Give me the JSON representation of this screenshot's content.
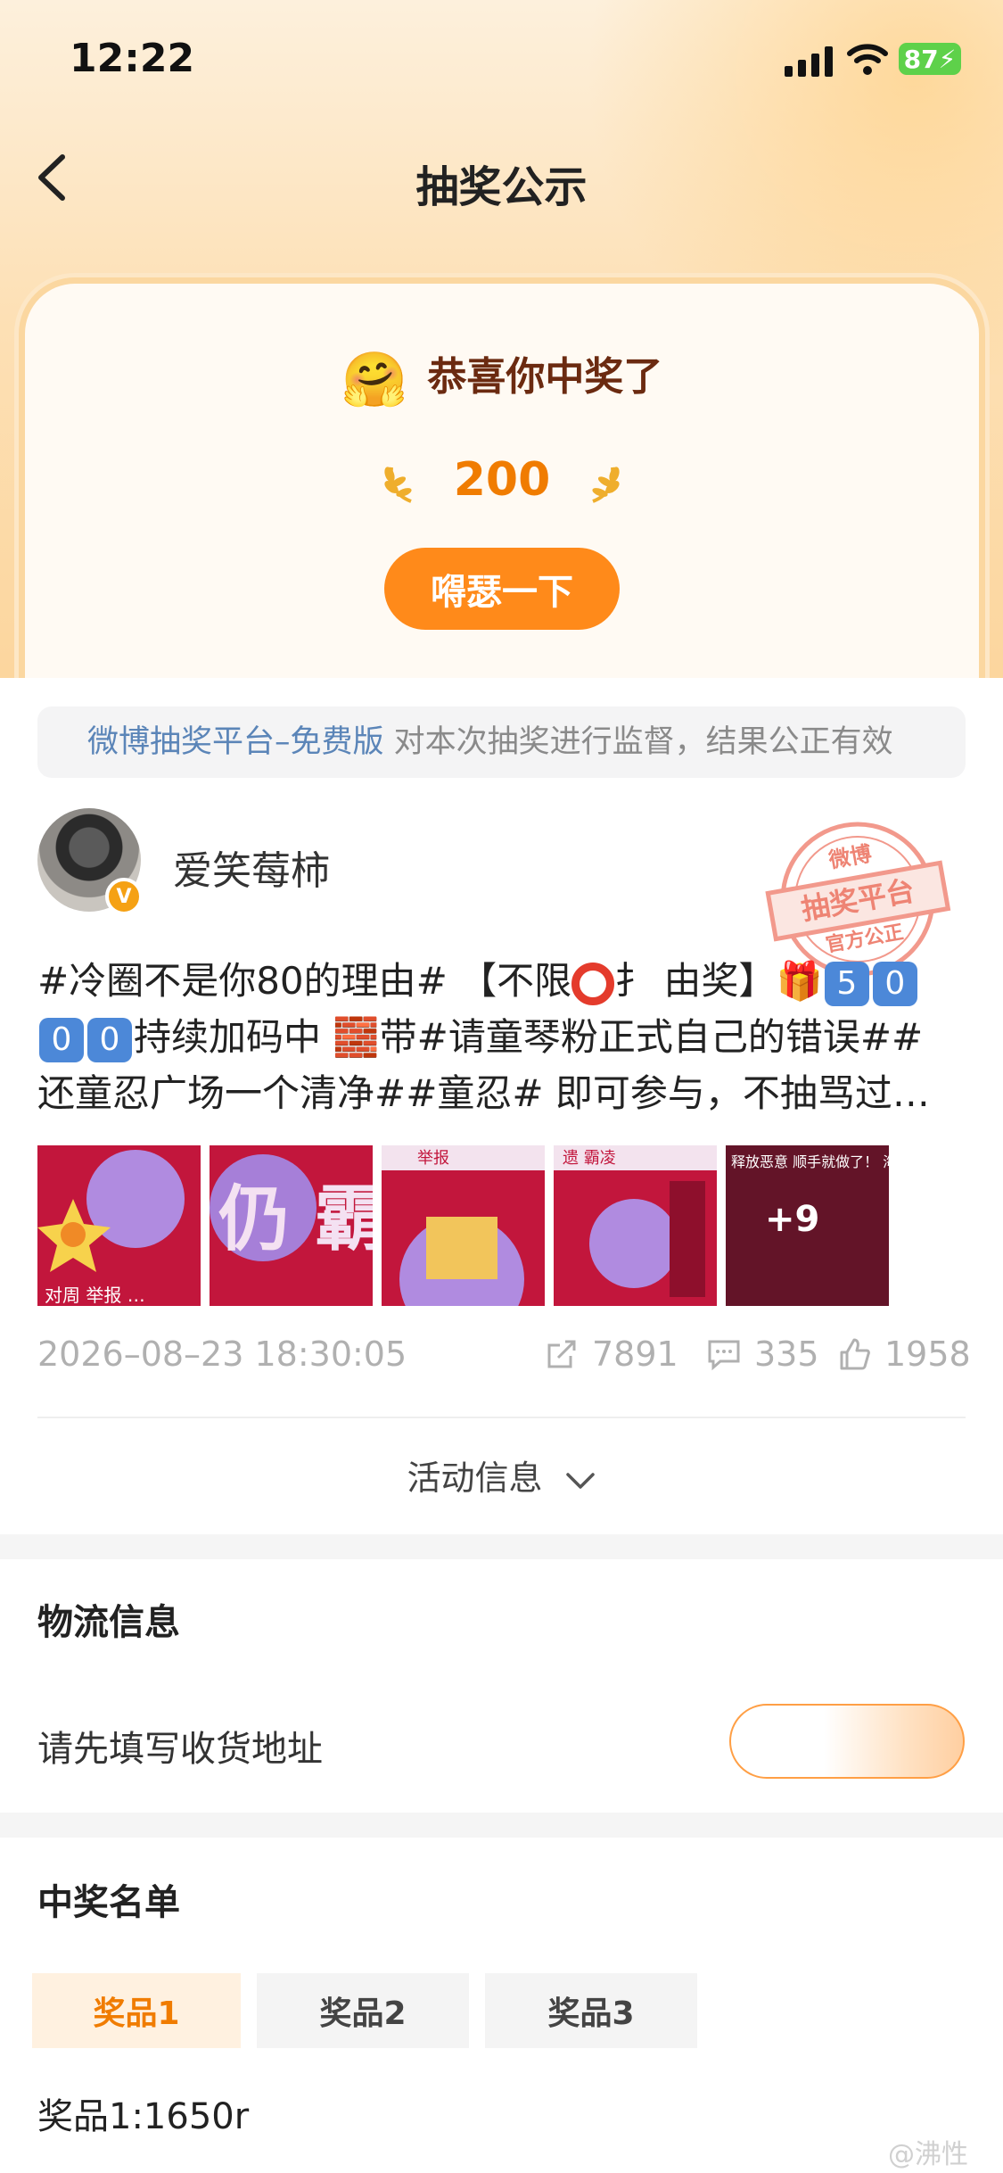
{
  "status_bar": {
    "time": "12:22",
    "battery": "87"
  },
  "nav": {
    "title": "抽奖公示"
  },
  "win_card": {
    "message": "恭喜你中奖了",
    "emoji": "🤗",
    "amount": "200",
    "button_label": "嘚瑟一下"
  },
  "notice": {
    "platform": "微博抽奖平台–免费版",
    "text": " 对本次抽奖进行监督，结果公正有效"
  },
  "post": {
    "username": "爱笑莓柿",
    "badge": "V",
    "stamp": {
      "line1": "微博",
      "line2": "抽奖平台",
      "line3": "官方公正"
    },
    "line1_a": "#冷圈不是你80的理由# 【不限",
    "line1_b": "扌 由奖】",
    "gift_emoji": "🎁",
    "keycap_5": "5",
    "keycap_0": "0",
    "line2_text": "持续加码中 ",
    "brick_emoji": "🧱",
    "line2_b": "带#请童琴粉正式自己的错误##",
    "line3": "还童忍广场一个清净##童忍# 即可参与，不抽骂过…",
    "thumbnails": [
      {
        "caption": "对周 举报 …"
      },
      {
        "caption": "仍 霸"
      },
      {
        "caption": "举报"
      },
      {
        "caption": "遗 霸凌"
      },
      {
        "caption": "释放恶意 顺手就做了！ 海外同好repo 游客gc",
        "more": "+9"
      }
    ],
    "date": "2026–08–23 18:30:05",
    "reposts": "7891",
    "comments": "335",
    "likes": "1958"
  },
  "activity": {
    "label": "活动信息"
  },
  "logistics": {
    "title": "物流信息",
    "address_prompt": "请先填写收货地址"
  },
  "winners": {
    "title": "中奖名单",
    "tabs": [
      "奖品1",
      "奖品2",
      "奖品3"
    ],
    "active_tab": 0,
    "prize_line": "奖品1:1650r"
  },
  "watermark": "@沸性",
  "colors": {
    "accent": "#ff8a1a",
    "link": "#5b85b8",
    "keycap": "#4c88d8"
  }
}
